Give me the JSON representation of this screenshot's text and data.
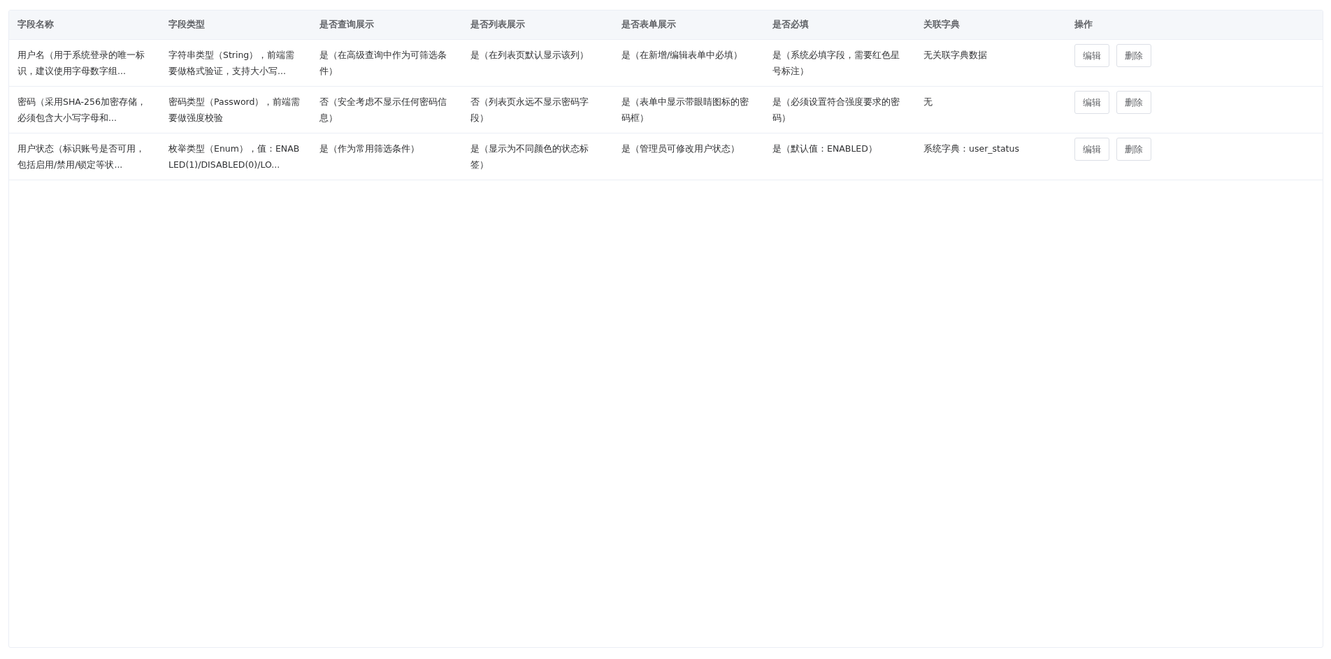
{
  "table": {
    "columns": [
      "字段名称",
      "字段类型",
      "是否查询展示",
      "是否列表展示",
      "是否表单展示",
      "是否必填",
      "关联字典",
      "操作"
    ],
    "rows": [
      {
        "cells": [
          "用户名（用于系统登录的唯一标识，建议使用字母数字组...",
          "字符串类型（String），前端需要做格式验证，支持大小写...",
          "是（在高级查询中作为可筛选条件）",
          "是（在列表页默认显示该列）",
          "是（在新增/编辑表单中必填）",
          "是（系统必填字段，需要红色星号标注）",
          "无关联字典数据"
        ],
        "actions": [
          "编辑",
          "删除"
        ]
      },
      {
        "cells": [
          "密码（采用SHA-256加密存储，必须包含大小写字母和...",
          "密码类型（Password），前端需要做强度校验",
          "否（安全考虑不显示任何密码信息）",
          "否（列表页永远不显示密码字段）",
          "是（表单中显示带眼睛图标的密码框）",
          "是（必须设置符合强度要求的密码）",
          "无"
        ],
        "actions": [
          "编辑",
          "删除"
        ]
      },
      {
        "cells": [
          "用户状态（标识账号是否可用，包括启用/禁用/锁定等状...",
          "枚举类型（Enum），值：ENABLED(1)/DISABLED(0)/LO...",
          "是（作为常用筛选条件）",
          "是（显示为不同颜色的状态标签）",
          "是（管理员可修改用户状态）",
          "是（默认值：ENABLED）",
          "系统字典：user_status"
        ],
        "actions": [
          "编辑",
          "删除"
        ]
      }
    ]
  }
}
